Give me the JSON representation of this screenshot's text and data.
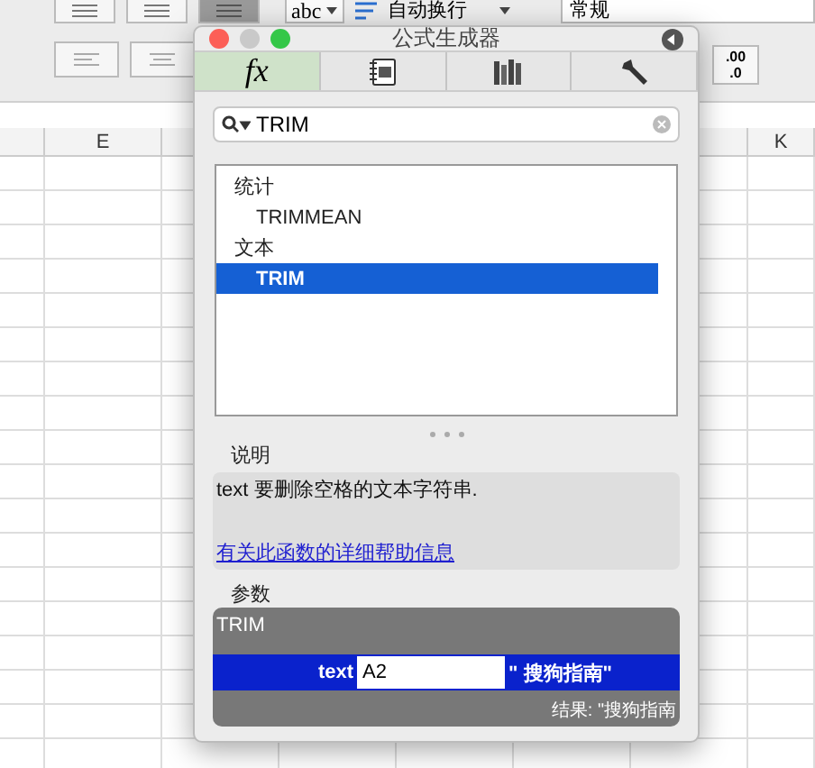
{
  "toolbar": {
    "wrap_style": "abc",
    "wrap_text": "自动换行",
    "number_format": "常规",
    "decimal_top": ".00",
    "decimal_bottom": ".0"
  },
  "sheet": {
    "columns": [
      {
        "label": "E"
      },
      {
        "label": "K"
      }
    ]
  },
  "dialog": {
    "title": "公式生成器",
    "tabs": [
      {
        "kind": "text",
        "label": "fx",
        "selected": true
      },
      {
        "kind": "gallery",
        "selected": false
      },
      {
        "kind": "library",
        "selected": false
      },
      {
        "kind": "tools",
        "selected": false
      }
    ],
    "search": {
      "value": "TRIM"
    },
    "results": [
      {
        "kind": "group",
        "label": "统计",
        "selected": false
      },
      {
        "kind": "item",
        "label": "TRIMMEAN",
        "selected": false
      },
      {
        "kind": "group",
        "label": "文本",
        "selected": false
      },
      {
        "kind": "item",
        "label": "TRIM",
        "selected": true
      }
    ],
    "description_label": "说明",
    "description": "text 要删除空格的文本字符串.",
    "help_link": "有关此函数的详细帮助信息",
    "arguments_label": "参数",
    "function_name": "TRIM",
    "arguments": [
      {
        "name": "text",
        "value": "A2",
        "evaluated": "\" 搜狗指南\""
      }
    ],
    "result": "结果: \"搜狗指南"
  }
}
